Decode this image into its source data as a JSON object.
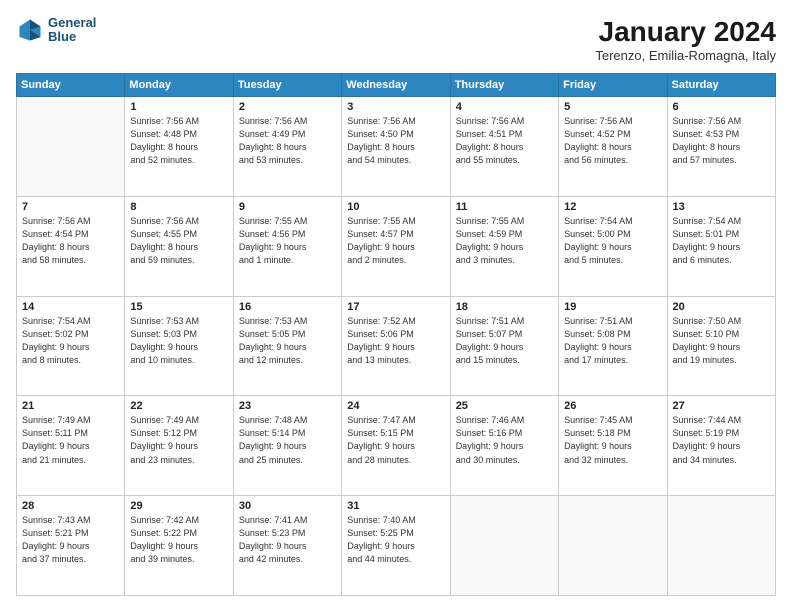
{
  "header": {
    "logo_line1": "General",
    "logo_line2": "Blue",
    "title": "January 2024",
    "location": "Terenzo, Emilia-Romagna, Italy"
  },
  "days_of_week": [
    "Sunday",
    "Monday",
    "Tuesday",
    "Wednesday",
    "Thursday",
    "Friday",
    "Saturday"
  ],
  "weeks": [
    [
      {
        "day": "",
        "info": ""
      },
      {
        "day": "1",
        "info": "Sunrise: 7:56 AM\nSunset: 4:48 PM\nDaylight: 8 hours\nand 52 minutes."
      },
      {
        "day": "2",
        "info": "Sunrise: 7:56 AM\nSunset: 4:49 PM\nDaylight: 8 hours\nand 53 minutes."
      },
      {
        "day": "3",
        "info": "Sunrise: 7:56 AM\nSunset: 4:50 PM\nDaylight: 8 hours\nand 54 minutes."
      },
      {
        "day": "4",
        "info": "Sunrise: 7:56 AM\nSunset: 4:51 PM\nDaylight: 8 hours\nand 55 minutes."
      },
      {
        "day": "5",
        "info": "Sunrise: 7:56 AM\nSunset: 4:52 PM\nDaylight: 8 hours\nand 56 minutes."
      },
      {
        "day": "6",
        "info": "Sunrise: 7:56 AM\nSunset: 4:53 PM\nDaylight: 8 hours\nand 57 minutes."
      }
    ],
    [
      {
        "day": "7",
        "info": "Sunrise: 7:56 AM\nSunset: 4:54 PM\nDaylight: 8 hours\nand 58 minutes."
      },
      {
        "day": "8",
        "info": "Sunrise: 7:56 AM\nSunset: 4:55 PM\nDaylight: 8 hours\nand 59 minutes."
      },
      {
        "day": "9",
        "info": "Sunrise: 7:55 AM\nSunset: 4:56 PM\nDaylight: 9 hours\nand 1 minute."
      },
      {
        "day": "10",
        "info": "Sunrise: 7:55 AM\nSunset: 4:57 PM\nDaylight: 9 hours\nand 2 minutes."
      },
      {
        "day": "11",
        "info": "Sunrise: 7:55 AM\nSunset: 4:59 PM\nDaylight: 9 hours\nand 3 minutes."
      },
      {
        "day": "12",
        "info": "Sunrise: 7:54 AM\nSunset: 5:00 PM\nDaylight: 9 hours\nand 5 minutes."
      },
      {
        "day": "13",
        "info": "Sunrise: 7:54 AM\nSunset: 5:01 PM\nDaylight: 9 hours\nand 6 minutes."
      }
    ],
    [
      {
        "day": "14",
        "info": "Sunrise: 7:54 AM\nSunset: 5:02 PM\nDaylight: 9 hours\nand 8 minutes."
      },
      {
        "day": "15",
        "info": "Sunrise: 7:53 AM\nSunset: 5:03 PM\nDaylight: 9 hours\nand 10 minutes."
      },
      {
        "day": "16",
        "info": "Sunrise: 7:53 AM\nSunset: 5:05 PM\nDaylight: 9 hours\nand 12 minutes."
      },
      {
        "day": "17",
        "info": "Sunrise: 7:52 AM\nSunset: 5:06 PM\nDaylight: 9 hours\nand 13 minutes."
      },
      {
        "day": "18",
        "info": "Sunrise: 7:51 AM\nSunset: 5:07 PM\nDaylight: 9 hours\nand 15 minutes."
      },
      {
        "day": "19",
        "info": "Sunrise: 7:51 AM\nSunset: 5:08 PM\nDaylight: 9 hours\nand 17 minutes."
      },
      {
        "day": "20",
        "info": "Sunrise: 7:50 AM\nSunset: 5:10 PM\nDaylight: 9 hours\nand 19 minutes."
      }
    ],
    [
      {
        "day": "21",
        "info": "Sunrise: 7:49 AM\nSunset: 5:11 PM\nDaylight: 9 hours\nand 21 minutes."
      },
      {
        "day": "22",
        "info": "Sunrise: 7:49 AM\nSunset: 5:12 PM\nDaylight: 9 hours\nand 23 minutes."
      },
      {
        "day": "23",
        "info": "Sunrise: 7:48 AM\nSunset: 5:14 PM\nDaylight: 9 hours\nand 25 minutes."
      },
      {
        "day": "24",
        "info": "Sunrise: 7:47 AM\nSunset: 5:15 PM\nDaylight: 9 hours\nand 28 minutes."
      },
      {
        "day": "25",
        "info": "Sunrise: 7:46 AM\nSunset: 5:16 PM\nDaylight: 9 hours\nand 30 minutes."
      },
      {
        "day": "26",
        "info": "Sunrise: 7:45 AM\nSunset: 5:18 PM\nDaylight: 9 hours\nand 32 minutes."
      },
      {
        "day": "27",
        "info": "Sunrise: 7:44 AM\nSunset: 5:19 PM\nDaylight: 9 hours\nand 34 minutes."
      }
    ],
    [
      {
        "day": "28",
        "info": "Sunrise: 7:43 AM\nSunset: 5:21 PM\nDaylight: 9 hours\nand 37 minutes."
      },
      {
        "day": "29",
        "info": "Sunrise: 7:42 AM\nSunset: 5:22 PM\nDaylight: 9 hours\nand 39 minutes."
      },
      {
        "day": "30",
        "info": "Sunrise: 7:41 AM\nSunset: 5:23 PM\nDaylight: 9 hours\nand 42 minutes."
      },
      {
        "day": "31",
        "info": "Sunrise: 7:40 AM\nSunset: 5:25 PM\nDaylight: 9 hours\nand 44 minutes."
      },
      {
        "day": "",
        "info": ""
      },
      {
        "day": "",
        "info": ""
      },
      {
        "day": "",
        "info": ""
      }
    ]
  ]
}
